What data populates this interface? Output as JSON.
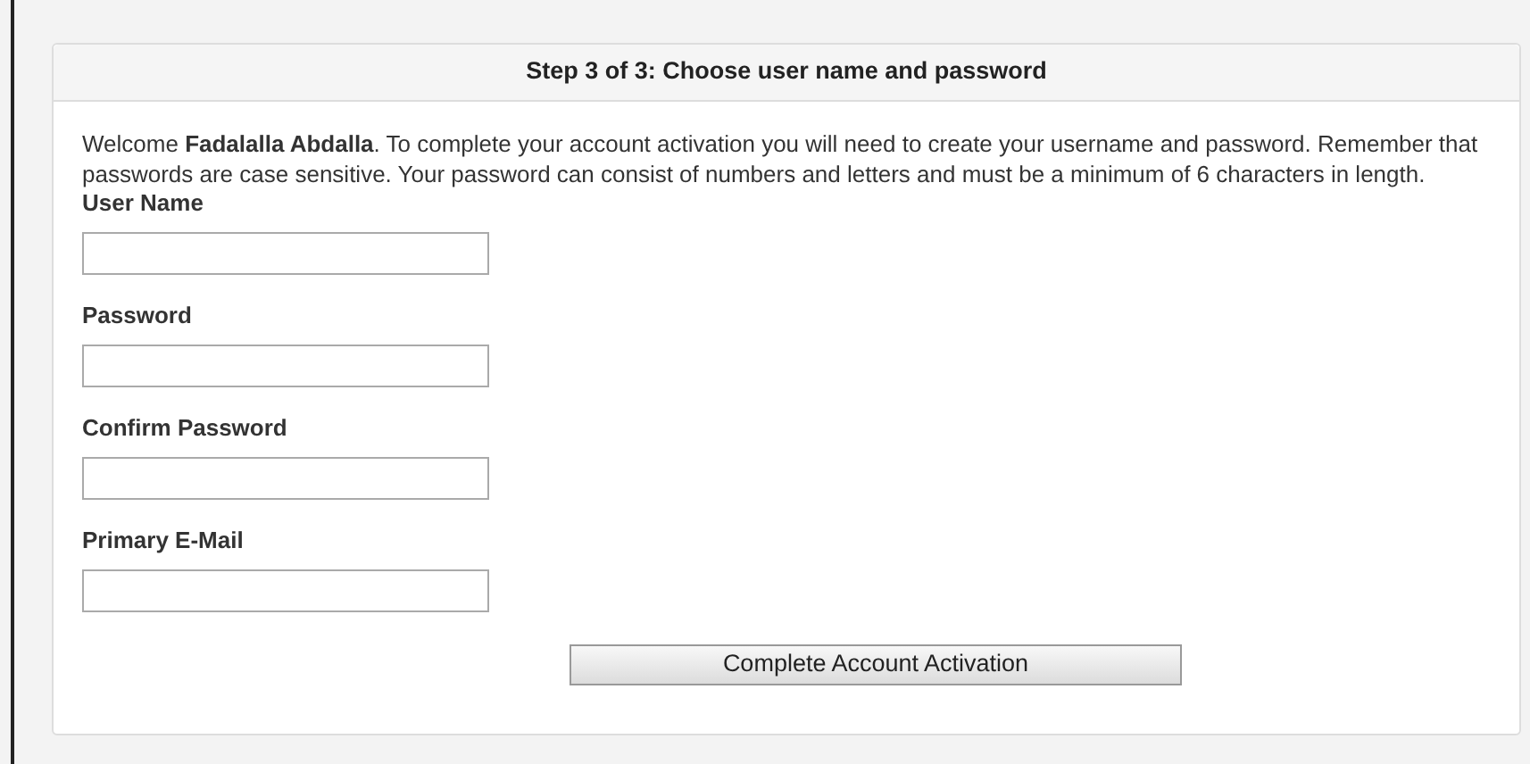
{
  "panel": {
    "title": "Step 3 of 3: Choose user name and password",
    "intro": "Welcome **Fadalalla Abdalla**. To complete your account activation you will need to create your username and password. Remember that passwords are case sensitive. Your password can consist of numbers and letters and must be a minimum of 6 characters in length.",
    "fields": [
      {
        "label": "User Name"
      },
      {
        "label": "Password"
      },
      {
        "label": "Confirm Password"
      },
      {
        "label": "Primary E-Mail"
      }
    ],
    "button": "Complete Account Activation"
  }
}
